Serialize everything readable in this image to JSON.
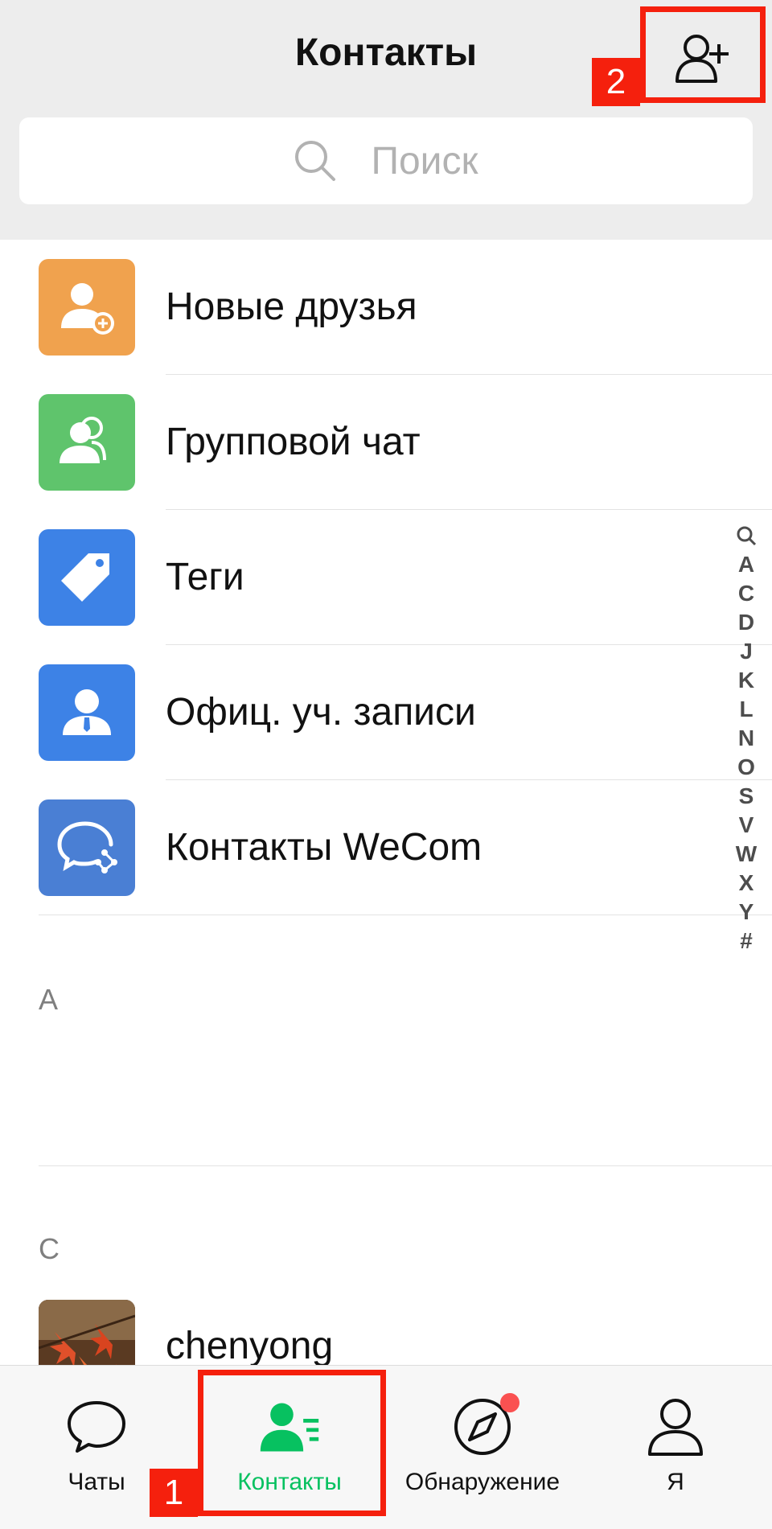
{
  "header": {
    "title": "Контакты",
    "search_placeholder": "Поиск"
  },
  "menu": [
    {
      "label": "Новые друзья",
      "icon": "new-friend-icon",
      "color": "#f0a24e"
    },
    {
      "label": "Групповой чат",
      "icon": "group-chat-icon",
      "color": "#5fc46c"
    },
    {
      "label": "Теги",
      "icon": "tag-icon",
      "color": "#3d82e6"
    },
    {
      "label": "Офиц. уч. записи",
      "icon": "official-account-icon",
      "color": "#3d82e6"
    },
    {
      "label": "Контакты WeCom",
      "icon": "wecom-icon",
      "color": "#4a7fd4"
    }
  ],
  "sections": [
    {
      "letter": "A"
    },
    {
      "letter": "C"
    }
  ],
  "contacts": [
    {
      "name": "chenyong",
      "avatar": "autumn-leaves-photo"
    }
  ],
  "index_bar": [
    "A",
    "C",
    "D",
    "J",
    "K",
    "L",
    "N",
    "O",
    "S",
    "V",
    "W",
    "X",
    "Y",
    "#"
  ],
  "tabbar": [
    {
      "label": "Чаты",
      "icon": "chat-bubble-icon",
      "active": false
    },
    {
      "label": "Контакты",
      "icon": "contacts-icon",
      "active": true
    },
    {
      "label": "Обнаружение",
      "icon": "compass-icon",
      "active": false,
      "badge": true
    },
    {
      "label": "Я",
      "icon": "person-icon",
      "active": false
    }
  ],
  "annotations": [
    {
      "number": "1"
    },
    {
      "number": "2"
    }
  ],
  "colors": {
    "accent_green": "#07c160",
    "annotation_red": "#f5200d",
    "header_bg": "#ededed"
  }
}
